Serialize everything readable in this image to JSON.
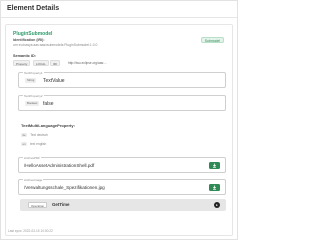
{
  "header": {
    "title": "Element Details"
  },
  "submodel": {
    "title": "PluginSubmodel",
    "id_label": "Identification (IRI):",
    "id_value": "urn:eu:basys:aas:aasxsubmodels:PluginSubmodel:1.0.0",
    "badge": "Submodel"
  },
  "semantic": {
    "label": "Semantic ID:",
    "chips": [
      "Property",
      "LOCAL",
      "IRI"
    ],
    "value": "http://iwu.eclipse.org/aas:..."
  },
  "fields": [
    {
      "label": "TextProperty1",
      "type": "String",
      "value": "TextValue"
    },
    {
      "label": "TextProperty2",
      "type": "Boolean",
      "value": "false"
    }
  ],
  "multilang": {
    "label": "TextMultiLanguageProperty:",
    "rows": [
      {
        "lang": "de",
        "text": "Text deutsch"
      },
      {
        "lang": "en",
        "text": "text english"
      }
    ]
  },
  "files": [
    {
      "label": "ArchivePDF",
      "value": "/HelloAssetAdministrationShell.pdf"
    },
    {
      "label": "ArchiveImage",
      "value": "/Verwaltungsschale_Spezifikationen.jpg"
    }
  ],
  "operation": {
    "chip": "Operation",
    "name": "GetTime"
  },
  "footer": {
    "text": "Last sync: 2022-03-15 10:00:22"
  }
}
